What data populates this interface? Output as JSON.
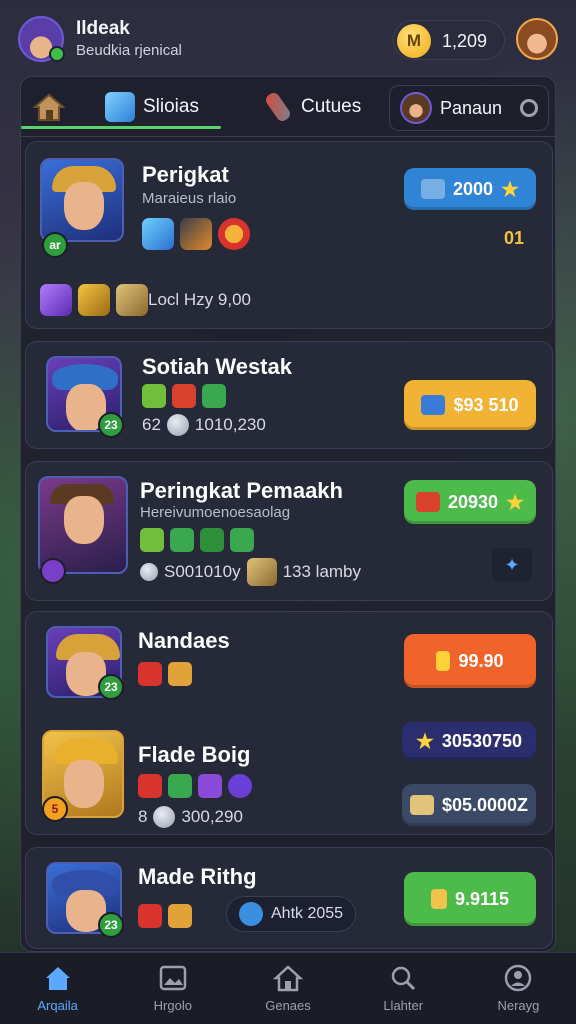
{
  "header": {
    "title": "Ildeak",
    "subtitle": "Beudkia rjenical",
    "coin_symbol": "M",
    "coin_value": "1,209"
  },
  "tabs": {
    "active_label": "Slioias",
    "second_label": "Cutues",
    "pill_label": "Panaun"
  },
  "cards": [
    {
      "name": "Perigkat",
      "subtitle": "Maraieus rlaio",
      "level": "ar",
      "price": "2000",
      "extra": "01",
      "stat": "Locl Hzy 9,00"
    },
    {
      "name": "Sotiah Westak",
      "level": "23",
      "stat_prefix": "62",
      "stat_value": "1010,230",
      "price": "$93 510"
    },
    {
      "name": "Peringkat Pemaakh",
      "subtitle": "Hereivumoenoesaolag",
      "stat_left": "S001010y",
      "stat_right": "133 lamby",
      "price": "20930"
    },
    {
      "name": "Nandaes",
      "level": "23",
      "price": "99.90"
    },
    {
      "name": "Flade Boig",
      "level": "5",
      "stat_prefix": "8",
      "stat_value": "300,290",
      "price_top": "30530750",
      "price_bottom": "$05.0000Z"
    },
    {
      "name": "Made Rithg",
      "level": "23",
      "pill_text": "Ahtk 2055",
      "price": "9.9115"
    }
  ],
  "nav": [
    {
      "label": "Arqaila",
      "icon": "home-icon"
    },
    {
      "label": "Hrgolo",
      "icon": "gallery-icon"
    },
    {
      "label": "Genaes",
      "icon": "house-icon"
    },
    {
      "label": "Llahter",
      "icon": "search-icon"
    },
    {
      "label": "Nerayg",
      "icon": "profile-icon"
    }
  ],
  "colors": {
    "accent_green": "#58d26a",
    "btn_blue": "#2f84d6",
    "btn_yellow": "#f2b233",
    "btn_green": "#4cbb4a",
    "btn_orange": "#f0642b",
    "btn_purple": "#2b2e6e",
    "nav_active": "#5aa8ff"
  }
}
